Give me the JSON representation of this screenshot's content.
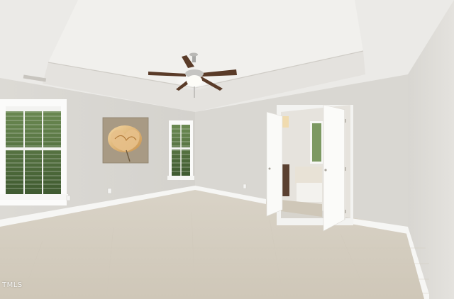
{
  "watermark": {
    "text": "TMLS"
  },
  "colors": {
    "wall": "#dcdad5",
    "ceiling": "#ecebe8",
    "carpet": "#dad3c6",
    "trim": "#f7f7f5",
    "fan_blade": "#5a3b28",
    "foliage": "#4f6b3c"
  },
  "icons": {
    "ceiling_fan": "ceiling-fan-icon",
    "artwork": "flower-painting-icon"
  }
}
